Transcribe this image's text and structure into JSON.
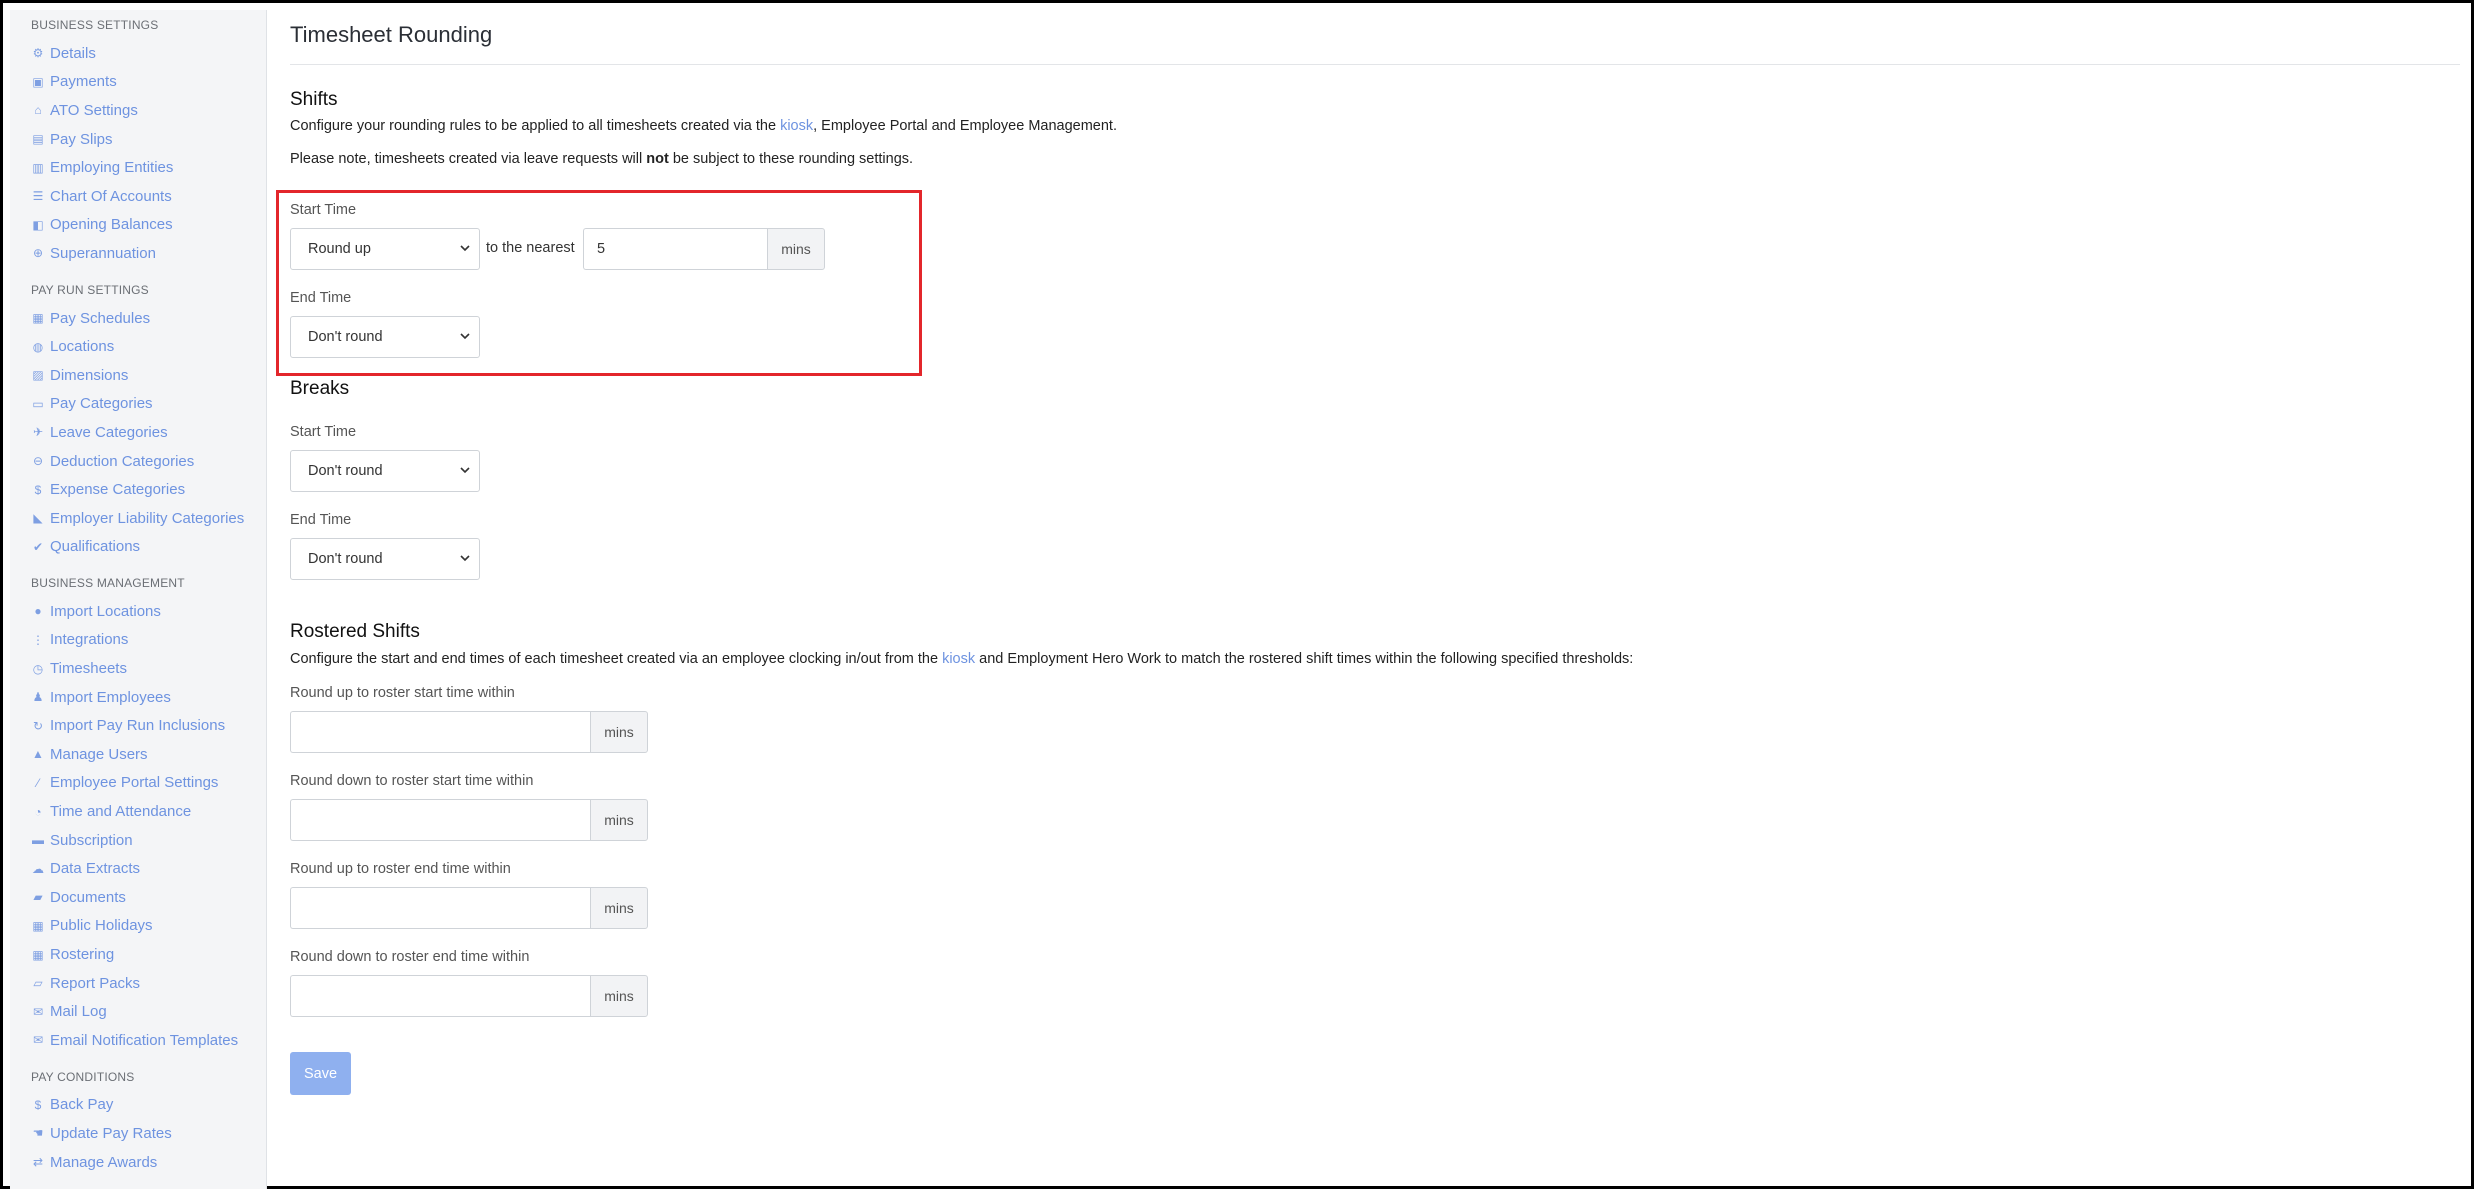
{
  "sidebar": {
    "sections": [
      {
        "title": "BUSINESS SETTINGS",
        "items": [
          {
            "label": "Details",
            "icon": "gear-icon"
          },
          {
            "label": "Payments",
            "icon": "save-icon"
          },
          {
            "label": "ATO Settings",
            "icon": "bank-icon"
          },
          {
            "label": "Pay Slips",
            "icon": "file-icon"
          },
          {
            "label": "Employing Entities",
            "icon": "building-icon"
          },
          {
            "label": "Chart Of Accounts",
            "icon": "list-icon"
          },
          {
            "label": "Opening Balances",
            "icon": "ledger-icon"
          },
          {
            "label": "Superannuation",
            "icon": "lifebuoy-icon"
          }
        ]
      },
      {
        "title": "PAY RUN SETTINGS",
        "items": [
          {
            "label": "Pay Schedules",
            "icon": "calendar-icon"
          },
          {
            "label": "Locations",
            "icon": "globe-icon"
          },
          {
            "label": "Dimensions",
            "icon": "chart-box-icon"
          },
          {
            "label": "Pay Categories",
            "icon": "money-icon"
          },
          {
            "label": "Leave Categories",
            "icon": "plane-icon"
          },
          {
            "label": "Deduction Categories",
            "icon": "minus-circle-icon"
          },
          {
            "label": "Expense Categories",
            "icon": "dollar-circle-icon"
          },
          {
            "label": "Employer Liability Categories",
            "icon": "area-chart-icon"
          },
          {
            "label": "Qualifications",
            "icon": "check-icon"
          }
        ]
      },
      {
        "title": "BUSINESS MANAGEMENT",
        "items": [
          {
            "label": "Import Locations",
            "icon": "pin-icon"
          },
          {
            "label": "Integrations",
            "icon": "plug-icon"
          },
          {
            "label": "Timesheets",
            "icon": "clock-icon"
          },
          {
            "label": "Import Employees",
            "icon": "people-icon"
          },
          {
            "label": "Import Pay Run Inclusions",
            "icon": "refresh-icon"
          },
          {
            "label": "Manage Users",
            "icon": "lock-icon"
          },
          {
            "label": "Employee Portal Settings",
            "icon": "wand-icon"
          },
          {
            "label": "Time and Attendance",
            "icon": "user-clock-icon"
          },
          {
            "label": "Subscription",
            "icon": "credit-card-icon"
          },
          {
            "label": "Data Extracts",
            "icon": "cloud-download-icon"
          },
          {
            "label": "Documents",
            "icon": "folder-icon"
          },
          {
            "label": "Public Holidays",
            "icon": "calendar-icon"
          },
          {
            "label": "Rostering",
            "icon": "roster-icon"
          },
          {
            "label": "Report Packs",
            "icon": "folder-open-icon"
          },
          {
            "label": "Mail Log",
            "icon": "envelope-open-icon"
          },
          {
            "label": "Email Notification Templates",
            "icon": "envelope-icon"
          }
        ]
      },
      {
        "title": "PAY CONDITIONS",
        "items": [
          {
            "label": "Back Pay",
            "icon": "dollar-back-icon"
          },
          {
            "label": "Update Pay Rates",
            "icon": "hand-money-icon"
          },
          {
            "label": "Manage Awards",
            "icon": "exchange-icon"
          }
        ]
      }
    ]
  },
  "page": {
    "title": "Timesheet Rounding"
  },
  "shifts": {
    "heading": "Shifts",
    "desc_before": "Configure your rounding rules to be applied to all timesheets created via the ",
    "desc_link": "kiosk",
    "desc_after": ", Employee Portal and Employee Management.",
    "note_before": "Please note, timesheets created via leave requests will ",
    "note_bold": "not",
    "note_after": " be subject to these rounding settings.",
    "start_label": "Start Time",
    "start_value": "Round up",
    "to_nearest": "to the nearest",
    "nearest_value": "5",
    "nearest_unit": "mins",
    "end_label": "End Time",
    "end_value": "Don't round"
  },
  "breaks": {
    "heading": "Breaks",
    "start_label": "Start Time",
    "start_value": "Don't round",
    "end_label": "End Time",
    "end_value": "Don't round"
  },
  "rostered": {
    "heading": "Rostered Shifts",
    "desc_before": "Configure the start and end times of each timesheet created via an employee clocking in/out from the ",
    "desc_link": "kiosk",
    "desc_after": " and Employment Hero Work to match the rostered shift times within the following specified thresholds:",
    "fields": [
      {
        "label": "Round up to roster start time within",
        "value": "",
        "unit": "mins"
      },
      {
        "label": "Round down to roster start time within",
        "value": "",
        "unit": "mins"
      },
      {
        "label": "Round up to roster end time within",
        "value": "",
        "unit": "mins"
      },
      {
        "label": "Round down to roster end time within",
        "value": "",
        "unit": "mins"
      }
    ]
  },
  "save_label": "Save",
  "colors": {
    "link": "#6e93e0",
    "highlight_border": "#e3262b",
    "save_button": "#8fb0ef"
  }
}
